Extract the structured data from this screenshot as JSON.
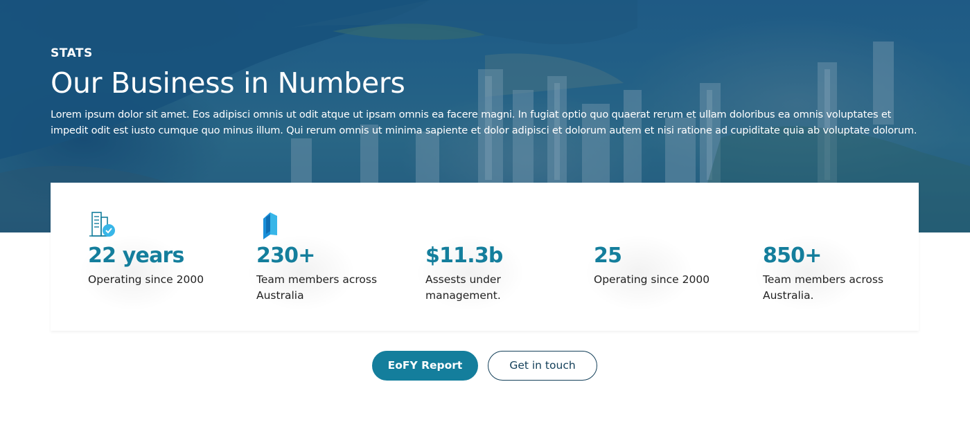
{
  "hero": {
    "eyebrow": "STATS",
    "title": "Our Business in Numbers",
    "description": "Lorem ipsum dolor sit amet. Eos adipisci omnis ut odit atque ut ipsam omnis ea facere magni. In fugiat optio quo quaerat rerum et ullam doloribus ea omnis voluptates et impedit odit est iusto cumque quo minus illum. Qui rerum omnis ut minima sapiente et dolor adipisci et dolorum autem et nisi ratione ad cupiditate quia ab voluptate dolorum.",
    "background_image": "aerial-city-harbour-photo"
  },
  "stats": [
    {
      "icon": "building-check-icon",
      "value": "22 years",
      "label": "Operating since 2000"
    },
    {
      "icon": "building-blocks-icon",
      "value": "230+",
      "label": "Team members across Australia"
    },
    {
      "icon": "",
      "value": "$11.3b",
      "label": "Assests under management."
    },
    {
      "icon": "",
      "value": "25",
      "label": "Operating since 2000"
    },
    {
      "icon": "",
      "value": "850+",
      "label": "Team members across Australia."
    }
  ],
  "actions": {
    "primary_label": "EoFY Report",
    "secondary_label": "Get in touch"
  },
  "colors": {
    "accent": "#147e9c",
    "dark_navy": "#14405a",
    "hero_overlay": "#0e4c78"
  }
}
